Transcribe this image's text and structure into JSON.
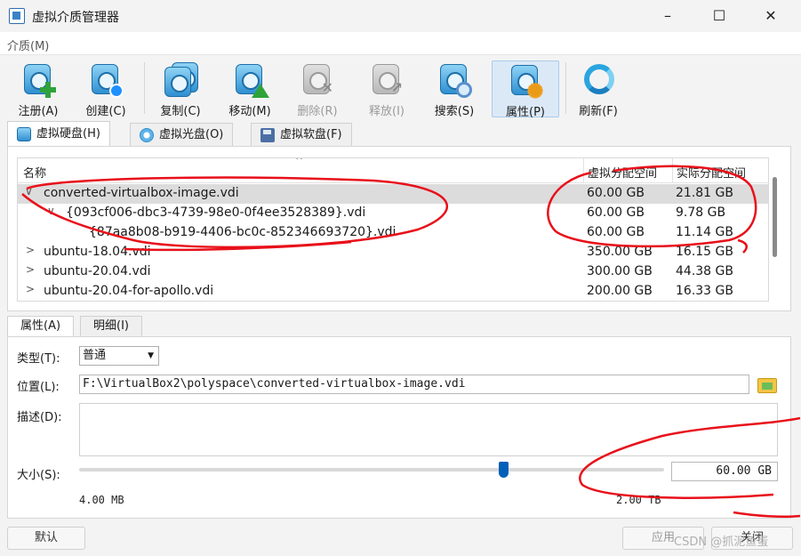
{
  "window": {
    "title": "虚拟介质管理器",
    "min": "–",
    "max": "☐",
    "close": "✕"
  },
  "menu": {
    "media": "介质(M)"
  },
  "toolbar": {
    "items": [
      {
        "label": "注册(A)",
        "icon": "register-icon",
        "enabled": true
      },
      {
        "label": "创建(C)",
        "icon": "create-icon",
        "enabled": true
      },
      {
        "label": "复制(C)",
        "icon": "copy-icon",
        "enabled": true
      },
      {
        "label": "移动(M)",
        "icon": "move-icon",
        "enabled": true
      },
      {
        "label": "删除(R)",
        "icon": "delete-icon",
        "enabled": false
      },
      {
        "label": "释放(I)",
        "icon": "release-icon",
        "enabled": false
      },
      {
        "label": "搜索(S)",
        "icon": "search-icon",
        "enabled": true
      },
      {
        "label": "属性(P)",
        "icon": "properties-icon",
        "enabled": true,
        "active": true
      },
      {
        "label": "刷新(F)",
        "icon": "refresh-icon",
        "enabled": true
      }
    ]
  },
  "tabs": [
    {
      "label": "虚拟硬盘(H)",
      "icon": "hard-disk-icon"
    },
    {
      "label": "虚拟光盘(O)",
      "icon": "optical-disk-icon"
    },
    {
      "label": "虚拟软盘(F)",
      "icon": "floppy-disk-icon"
    }
  ],
  "list": {
    "columns": {
      "name": "名称",
      "virtual": "虚拟分配空间",
      "actual": "实际分配空间",
      "sort_caret": "^"
    },
    "rows": [
      {
        "name": "converted-virtualbox-image.vdi",
        "virtual": "60.00 GB",
        "actual": "21.81 GB",
        "expander": "∨",
        "selected": true
      },
      {
        "name": "{093cf006-dbc3-4739-98e0-0f4ee3528389}.vdi",
        "virtual": "60.00 GB",
        "actual": "9.78 GB",
        "expander": "∨"
      },
      {
        "name": "{87aa8b08-b919-4406-bc0c-852346693720}.vdi",
        "virtual": "60.00 GB",
        "actual": "11.14 GB",
        "expander": ""
      },
      {
        "name": "ubuntu-18.04.vdi",
        "virtual": "350.00 GB",
        "actual": "16.15 GB",
        "expander": ">"
      },
      {
        "name": "ubuntu-20.04.vdi",
        "virtual": "300.00 GB",
        "actual": "44.38 GB",
        "expander": ">"
      },
      {
        "name": "ubuntu-20.04-for-apollo.vdi",
        "virtual": "200.00 GB",
        "actual": "16.33 GB",
        "expander": ">"
      }
    ]
  },
  "detail_tabs": [
    {
      "label": "属性(A)"
    },
    {
      "label": "明细(I)"
    }
  ],
  "properties": {
    "type_label": "类型(T):",
    "type_value": "普通",
    "type_arrow": "▼",
    "location_label": "位置(L):",
    "location_value": "F:\\VirtualBox2\\polyspace\\converted-virtualbox-image.vdi",
    "description_label": "描述(D):",
    "description_value": "",
    "size_label": "大小(S):",
    "size_value": "60.00 GB",
    "size_min": "4.00 MB",
    "size_max": "2.00 TB",
    "slider_fraction": 0.725
  },
  "footer": {
    "reset": "默认",
    "apply": "应用",
    "close": "关闭"
  },
  "watermark": "CSDN @抓泥鱼蛋",
  "colors": {
    "accent": "#005fb8",
    "annotation": "#e8101a",
    "selected_row": "#dcdcdc"
  }
}
